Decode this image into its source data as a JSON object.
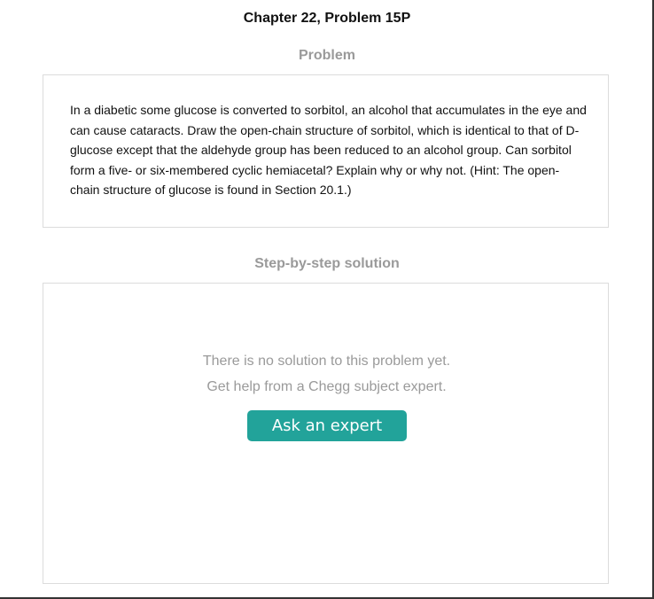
{
  "header": {
    "title": "Chapter 22, Problem 15P"
  },
  "problem": {
    "heading": "Problem",
    "text": "In a diabetic some glucose is converted to sorbitol, an alcohol that accumulates in the eye and can cause cataracts. Draw the open-chain structure of sorbitol, which is identical to that of D-glucose except that the aldehyde group has been reduced to an alcohol group. Can sorbitol form a five- or six-membered cyclic hemiacetal? Explain why or why not. (Hint: The open-chain structure of glucose is found in Section 20.1.)"
  },
  "solution": {
    "heading": "Step-by-step solution",
    "empty_message": "There is no solution to this problem yet.",
    "help_message": "Get help from a Chegg subject expert.",
    "button_label": "Ask an expert"
  },
  "colors": {
    "accent": "#22a39a",
    "muted_text": "#9a9a9a",
    "border": "#dcdcdc"
  }
}
